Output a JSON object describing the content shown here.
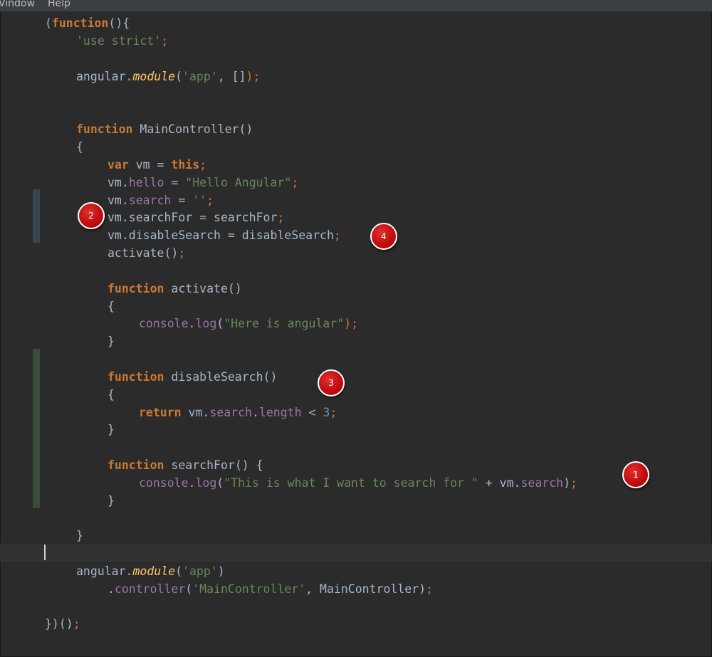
{
  "menu": {
    "items": [
      "Window",
      "Help"
    ],
    "visible": [
      "Vindow",
      "Help"
    ]
  },
  "code": {
    "l1": [
      "(",
      "function",
      "(){"
    ],
    "l2": [
      "'use strict'",
      ";"
    ],
    "l3": [
      "angular.",
      "module",
      "(",
      "'app'",
      ", []",
      ");"
    ],
    "l4": [
      "function ",
      "MainController",
      "()"
    ],
    "l5": "{",
    "l6": [
      "var ",
      "vm = ",
      "this",
      ";"
    ],
    "l7": [
      "vm.",
      "hello",
      " = ",
      "\"Hello Angular\"",
      ";"
    ],
    "l8": [
      "vm.",
      "search",
      " = ",
      "''",
      ";"
    ],
    "l9": [
      "vm.searchFor = searchFor",
      ";"
    ],
    "l10": [
      "vm.disableSearch = disableSearch",
      ";"
    ],
    "l11": [
      "activate()",
      ";"
    ],
    "l12": [
      "function ",
      "activate",
      "()"
    ],
    "l13": "{",
    "l14": [
      "console",
      ".",
      "log",
      "(",
      "\"Here is angular\"",
      ");"
    ],
    "l15": "}",
    "l16": [
      "function ",
      "disableSearch",
      "()"
    ],
    "l17": "{",
    "l18": [
      "return ",
      "vm.",
      "search",
      ".",
      "length",
      " < ",
      "3",
      ";"
    ],
    "l19": "}",
    "l20": [
      "function ",
      "searchFor",
      "() {"
    ],
    "l21": [
      "console",
      ".",
      "log",
      "(",
      "\"This is what I want to search for \"",
      " + vm.",
      "search",
      ")",
      ";"
    ],
    "l22": "}",
    "l23": "}",
    "l24": [
      "angular.",
      "module",
      "(",
      "'app'",
      ")"
    ],
    "l25": [
      ".",
      "controller",
      "(",
      "'MainController'",
      ", MainController)",
      ";"
    ],
    "l26": [
      "})()",
      ";"
    ]
  },
  "markers": {
    "m1": "1",
    "m2": "2",
    "m3": "3",
    "m4": "4"
  },
  "colors": {
    "background": "#2b2b2b",
    "keyword": "#cc7832",
    "function": "#ffc66d",
    "string": "#6a8759",
    "number": "#6897bb",
    "property": "#9876aa",
    "plain": "#a9b7c6",
    "marker": "#c00e0e"
  }
}
